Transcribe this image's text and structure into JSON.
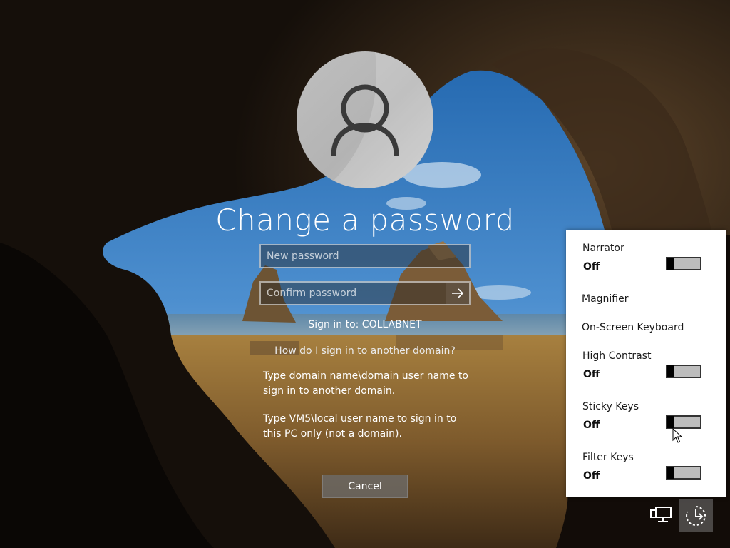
{
  "screen": {
    "title": "Change a password"
  },
  "form": {
    "new_password_placeholder": "New password",
    "confirm_password_placeholder": "Confirm password",
    "sign_in_to": "Sign in to: COLLABNET",
    "other_domain_link": "How do I sign in to another domain?",
    "help_line_1": "Type domain name\\domain user name to sign in to another domain.",
    "help_line_2": "Type VM5\\local user name to sign in to this PC only (not a domain).",
    "cancel_label": "Cancel"
  },
  "ease_of_access": {
    "items": [
      {
        "label": "Narrator",
        "state": "Off",
        "toggle_on": false
      },
      {
        "label": "Magnifier"
      },
      {
        "label": "On-Screen Keyboard"
      },
      {
        "label": "High Contrast",
        "state": "Off",
        "toggle_on": false
      },
      {
        "label": "Sticky Keys",
        "state": "Off",
        "toggle_on": false
      },
      {
        "label": "Filter Keys",
        "state": "Off",
        "toggle_on": false
      }
    ]
  },
  "icons": {
    "avatar": "user-icon",
    "submit": "arrow-right-icon",
    "network": "network-icon",
    "ease": "ease-of-access-icon"
  },
  "colors": {
    "panel_bg": "#ffffff",
    "toggle_track": "#bdbdbd",
    "toggle_thumb": "#000000",
    "cancel_bg": "#6e6e6e"
  }
}
